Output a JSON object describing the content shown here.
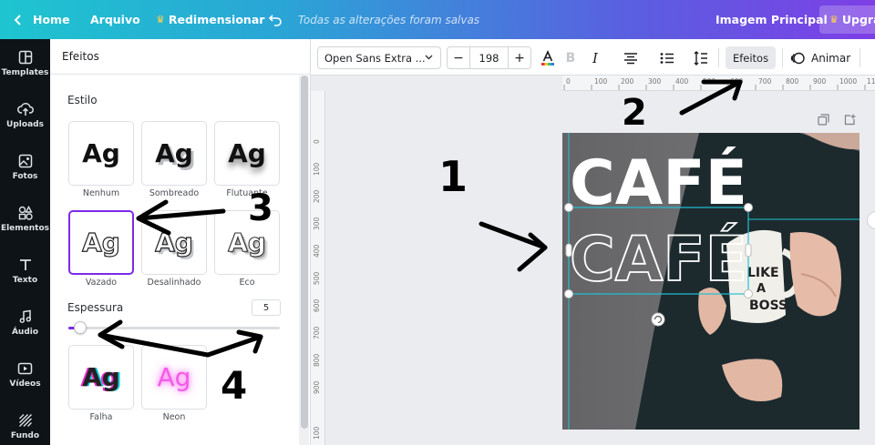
{
  "header": {
    "home_label": "Home",
    "file_label": "Arquivo",
    "resize_label": "Redimensionar",
    "saved_status": "Todas as alterações foram salvas",
    "title_label": "Imagem Principal",
    "upgrade_label": "Upgrad"
  },
  "sidebar": {
    "items": [
      {
        "label": "Templates",
        "icon": "templates-icon"
      },
      {
        "label": "Uploads",
        "icon": "upload-icon"
      },
      {
        "label": "Fotos",
        "icon": "photos-icon"
      },
      {
        "label": "Elementos",
        "icon": "elements-icon"
      },
      {
        "label": "Texto",
        "icon": "text-icon"
      },
      {
        "label": "Áudio",
        "icon": "audio-icon"
      },
      {
        "label": "Vídeos",
        "icon": "video-icon"
      },
      {
        "label": "Fundo",
        "icon": "background-icon"
      }
    ]
  },
  "panel": {
    "title": "Efeitos",
    "style_heading": "Estilo",
    "sample_text": "Ag",
    "effects": [
      {
        "label": "Nenhum",
        "selected": false
      },
      {
        "label": "Sombreado",
        "selected": false
      },
      {
        "label": "Flutuante",
        "selected": false
      },
      {
        "label": "Vazado",
        "selected": true
      },
      {
        "label": "Desalinhado",
        "selected": false
      },
      {
        "label": "Eco",
        "selected": false
      },
      {
        "label": "Falha",
        "selected": false
      },
      {
        "label": "Neon",
        "selected": false
      }
    ],
    "thickness_label": "Espessura",
    "thickness_value": "5",
    "thickness_fraction": 0.05
  },
  "toolbar": {
    "font_name": "Open Sans Extra ...",
    "font_size": "198",
    "minus": "−",
    "plus": "+",
    "bold": "B",
    "italic": "I",
    "effects_label": "Efeitos",
    "animate_label": "Animar"
  },
  "ruler": {
    "top_labels": [
      "0",
      "100",
      "200",
      "300",
      "400",
      "500",
      "600",
      "700",
      "800",
      "900",
      "1000",
      "11"
    ],
    "left_labels": [
      "0",
      "100",
      "200",
      "300",
      "400",
      "500",
      "600",
      "700",
      "800",
      "900",
      "100"
    ]
  },
  "design": {
    "headline": "CAFÉ",
    "outline_headline": "CAFÉ",
    "mug_text": [
      "LIKE",
      "A",
      "BOSS"
    ]
  },
  "annotations": [
    "1",
    "2",
    "3",
    "4"
  ],
  "colors": {
    "selected_border": "#7d2ae8",
    "selection_frame": "#21c1d6",
    "annotation_ink": "#000000"
  }
}
